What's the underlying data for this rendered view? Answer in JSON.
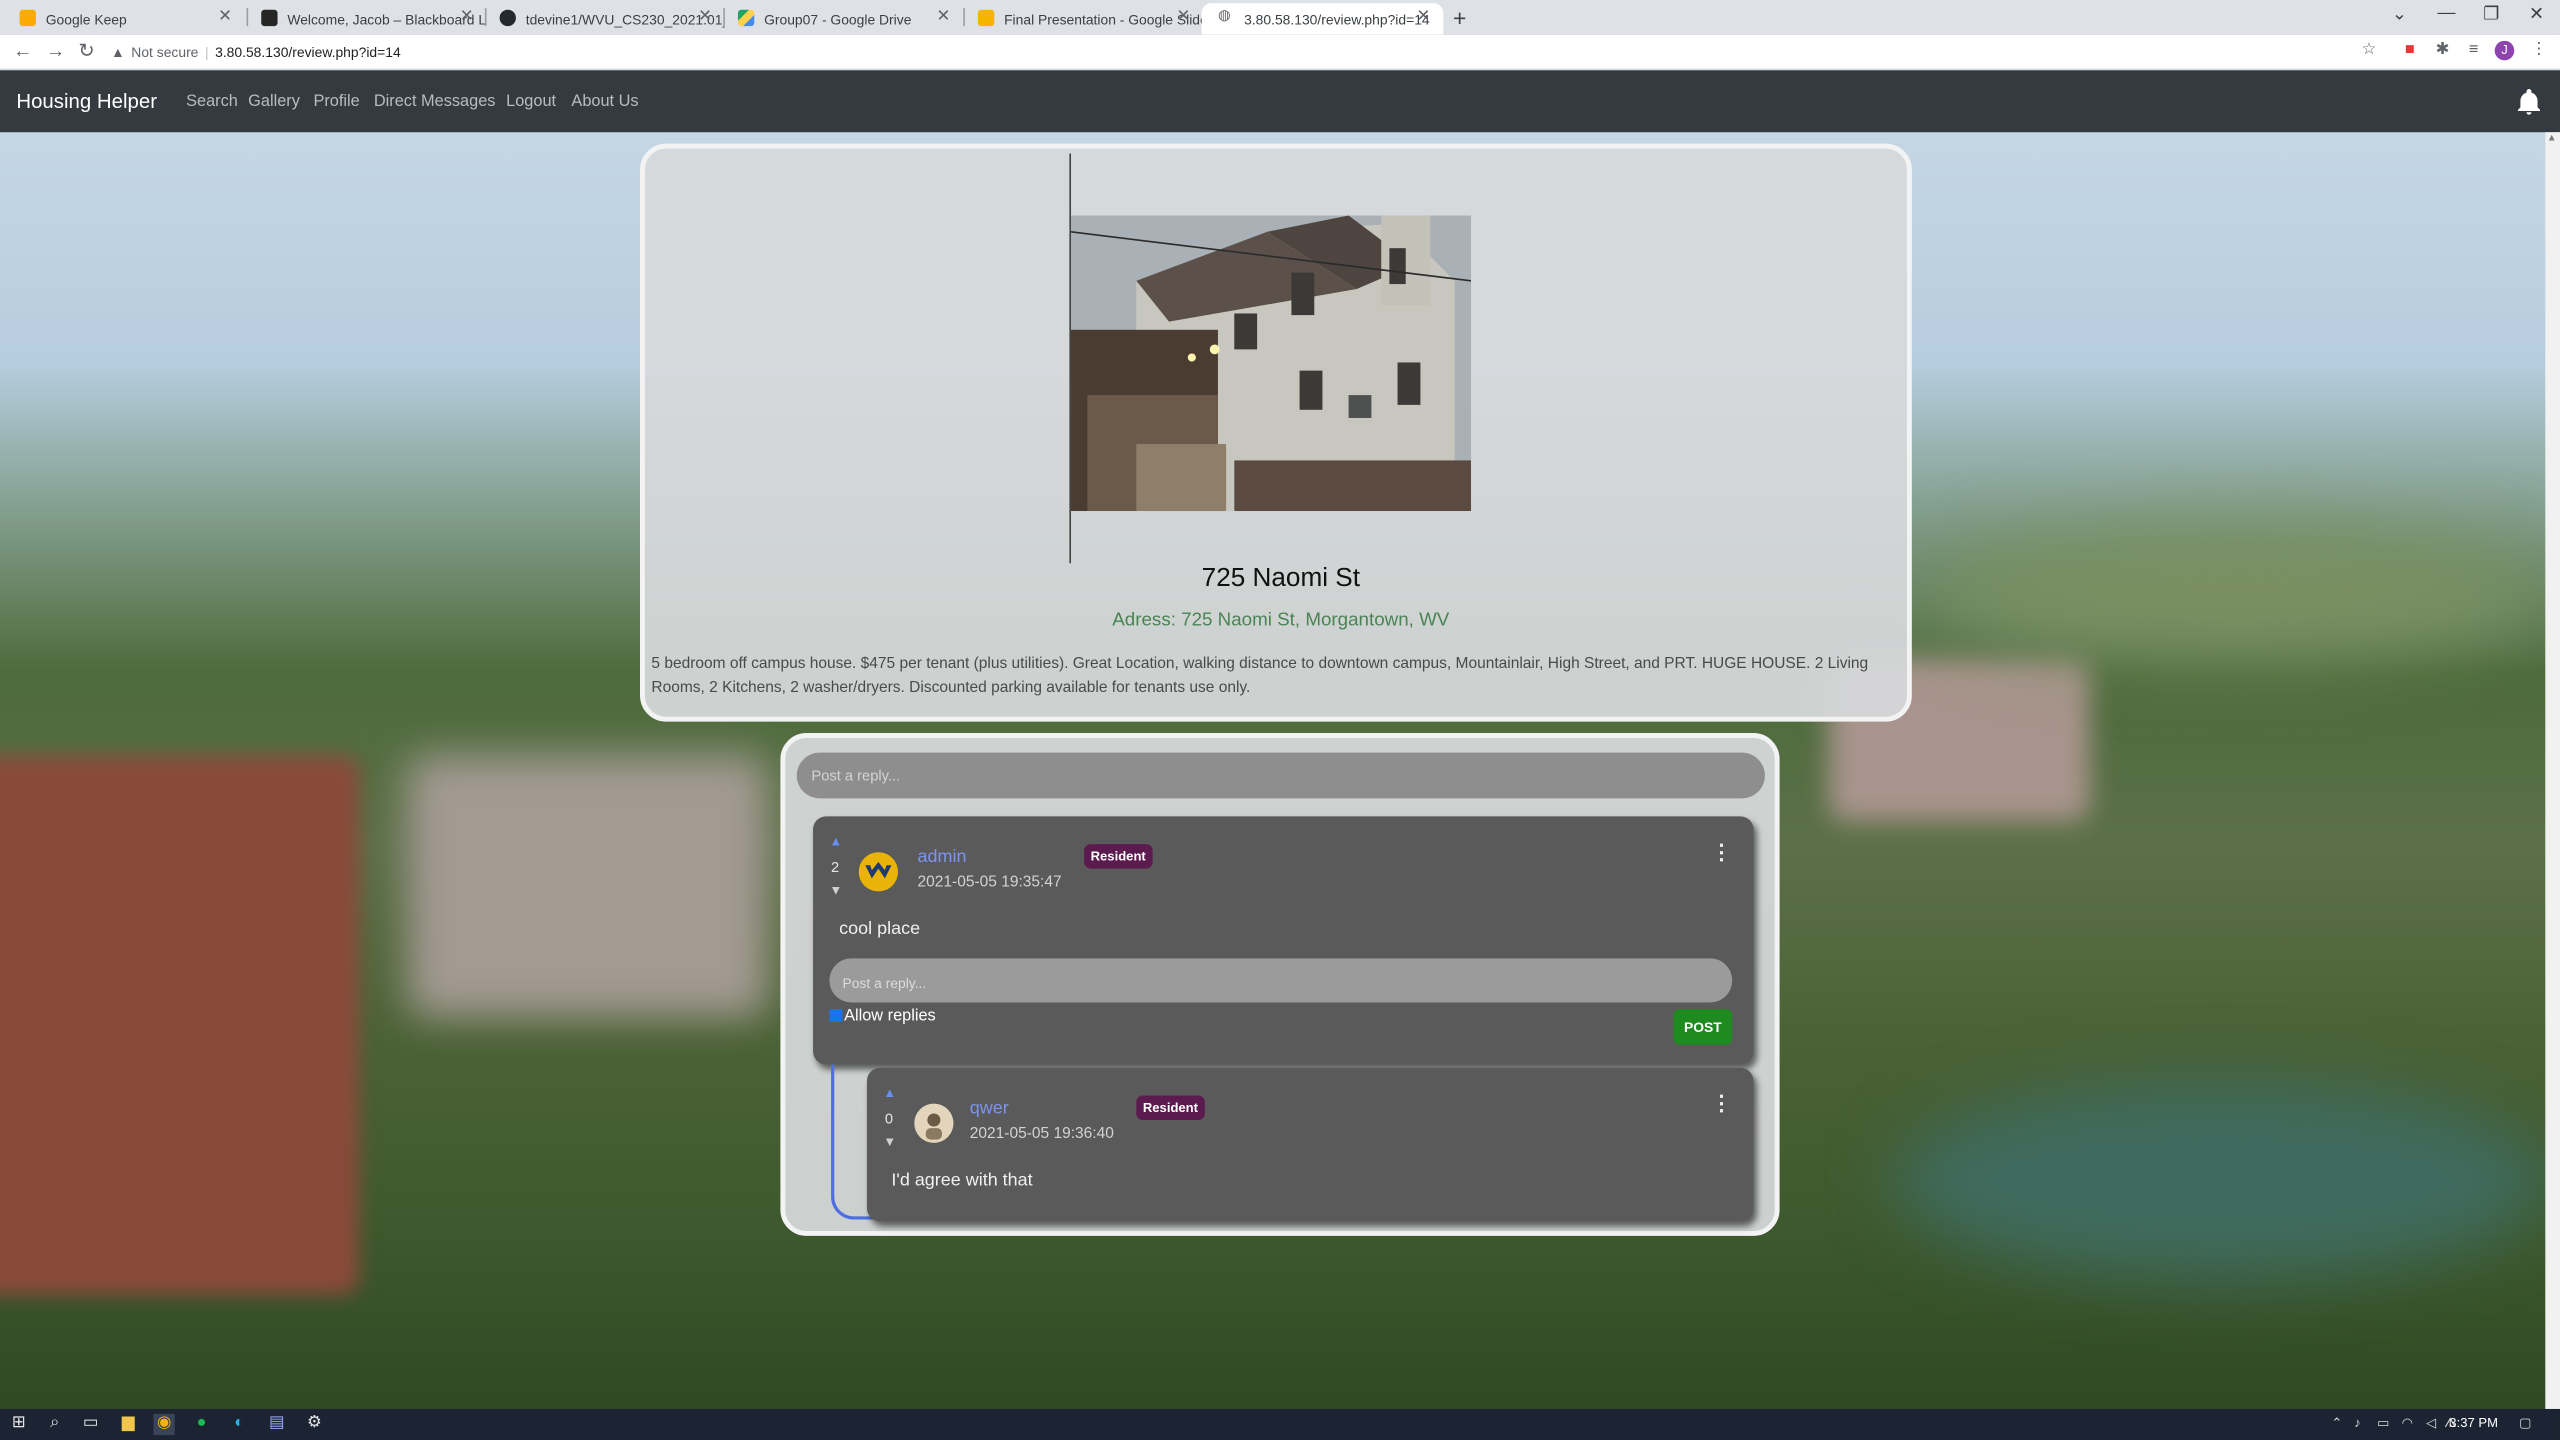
{
  "browser": {
    "tabs": [
      {
        "title": "Google Keep",
        "favicon_color": "#f9ab00",
        "active": false
      },
      {
        "title": "Welcome, Jacob – Blackboard Le",
        "favicon_color": "#262626",
        "active": false
      },
      {
        "title": "tdevine1/WVU_CS230_2021.01_G",
        "favicon_color": "#24292e",
        "active": false
      },
      {
        "title": "Group07 - Google Drive",
        "favicon_color": "#1fa463",
        "active": false
      },
      {
        "title": "Final Presentation - Google Slide",
        "favicon_color": "#f4b400",
        "active": false
      },
      {
        "title": "3.80.58.130/review.php?id=14",
        "favicon_color": "#5f6368",
        "active": true
      }
    ],
    "security_label": "Not secure",
    "url": "3.80.58.130/review.php?id=14"
  },
  "navbar": {
    "brand": "Housing Helper",
    "links": [
      "Search",
      "Gallery",
      "Profile",
      "Direct Messages",
      "Logout",
      "About Us"
    ]
  },
  "listing": {
    "title": "725 Naomi St",
    "address": "Adress: 725 Naomi St, Morgantown, WV",
    "description": "5 bedroom off campus house. $475 per tenant (plus utilities). Great Location, walking distance to downtown campus, Mountainlair, High Street, and PRT. HUGE HOUSE. 2 Living Rooms, 2 Kitchens, 2 washer/dryers. Discounted parking available for tenants use only."
  },
  "reviews": {
    "reply_placeholder": "Post a reply...",
    "comments": [
      {
        "votes": "2",
        "username": "admin",
        "timestamp": "2021-05-05 19:35:47",
        "badge": "Resident",
        "text": "cool place",
        "reply_placeholder": "Post a reply...",
        "allow_replies_label": "Allow replies",
        "post_label": "POST"
      },
      {
        "votes": "0",
        "username": "qwer",
        "timestamp": "2021-05-05 19:36:40",
        "badge": "Resident",
        "text": "I'd agree with that"
      }
    ]
  },
  "taskbar": {
    "time": "3:37 PM"
  },
  "colors": {
    "navbar": "#343a40",
    "username": "#7d94f2",
    "badge": "#5b1b4f",
    "post_button": "#1f8a1f",
    "address": "#4a8454"
  }
}
